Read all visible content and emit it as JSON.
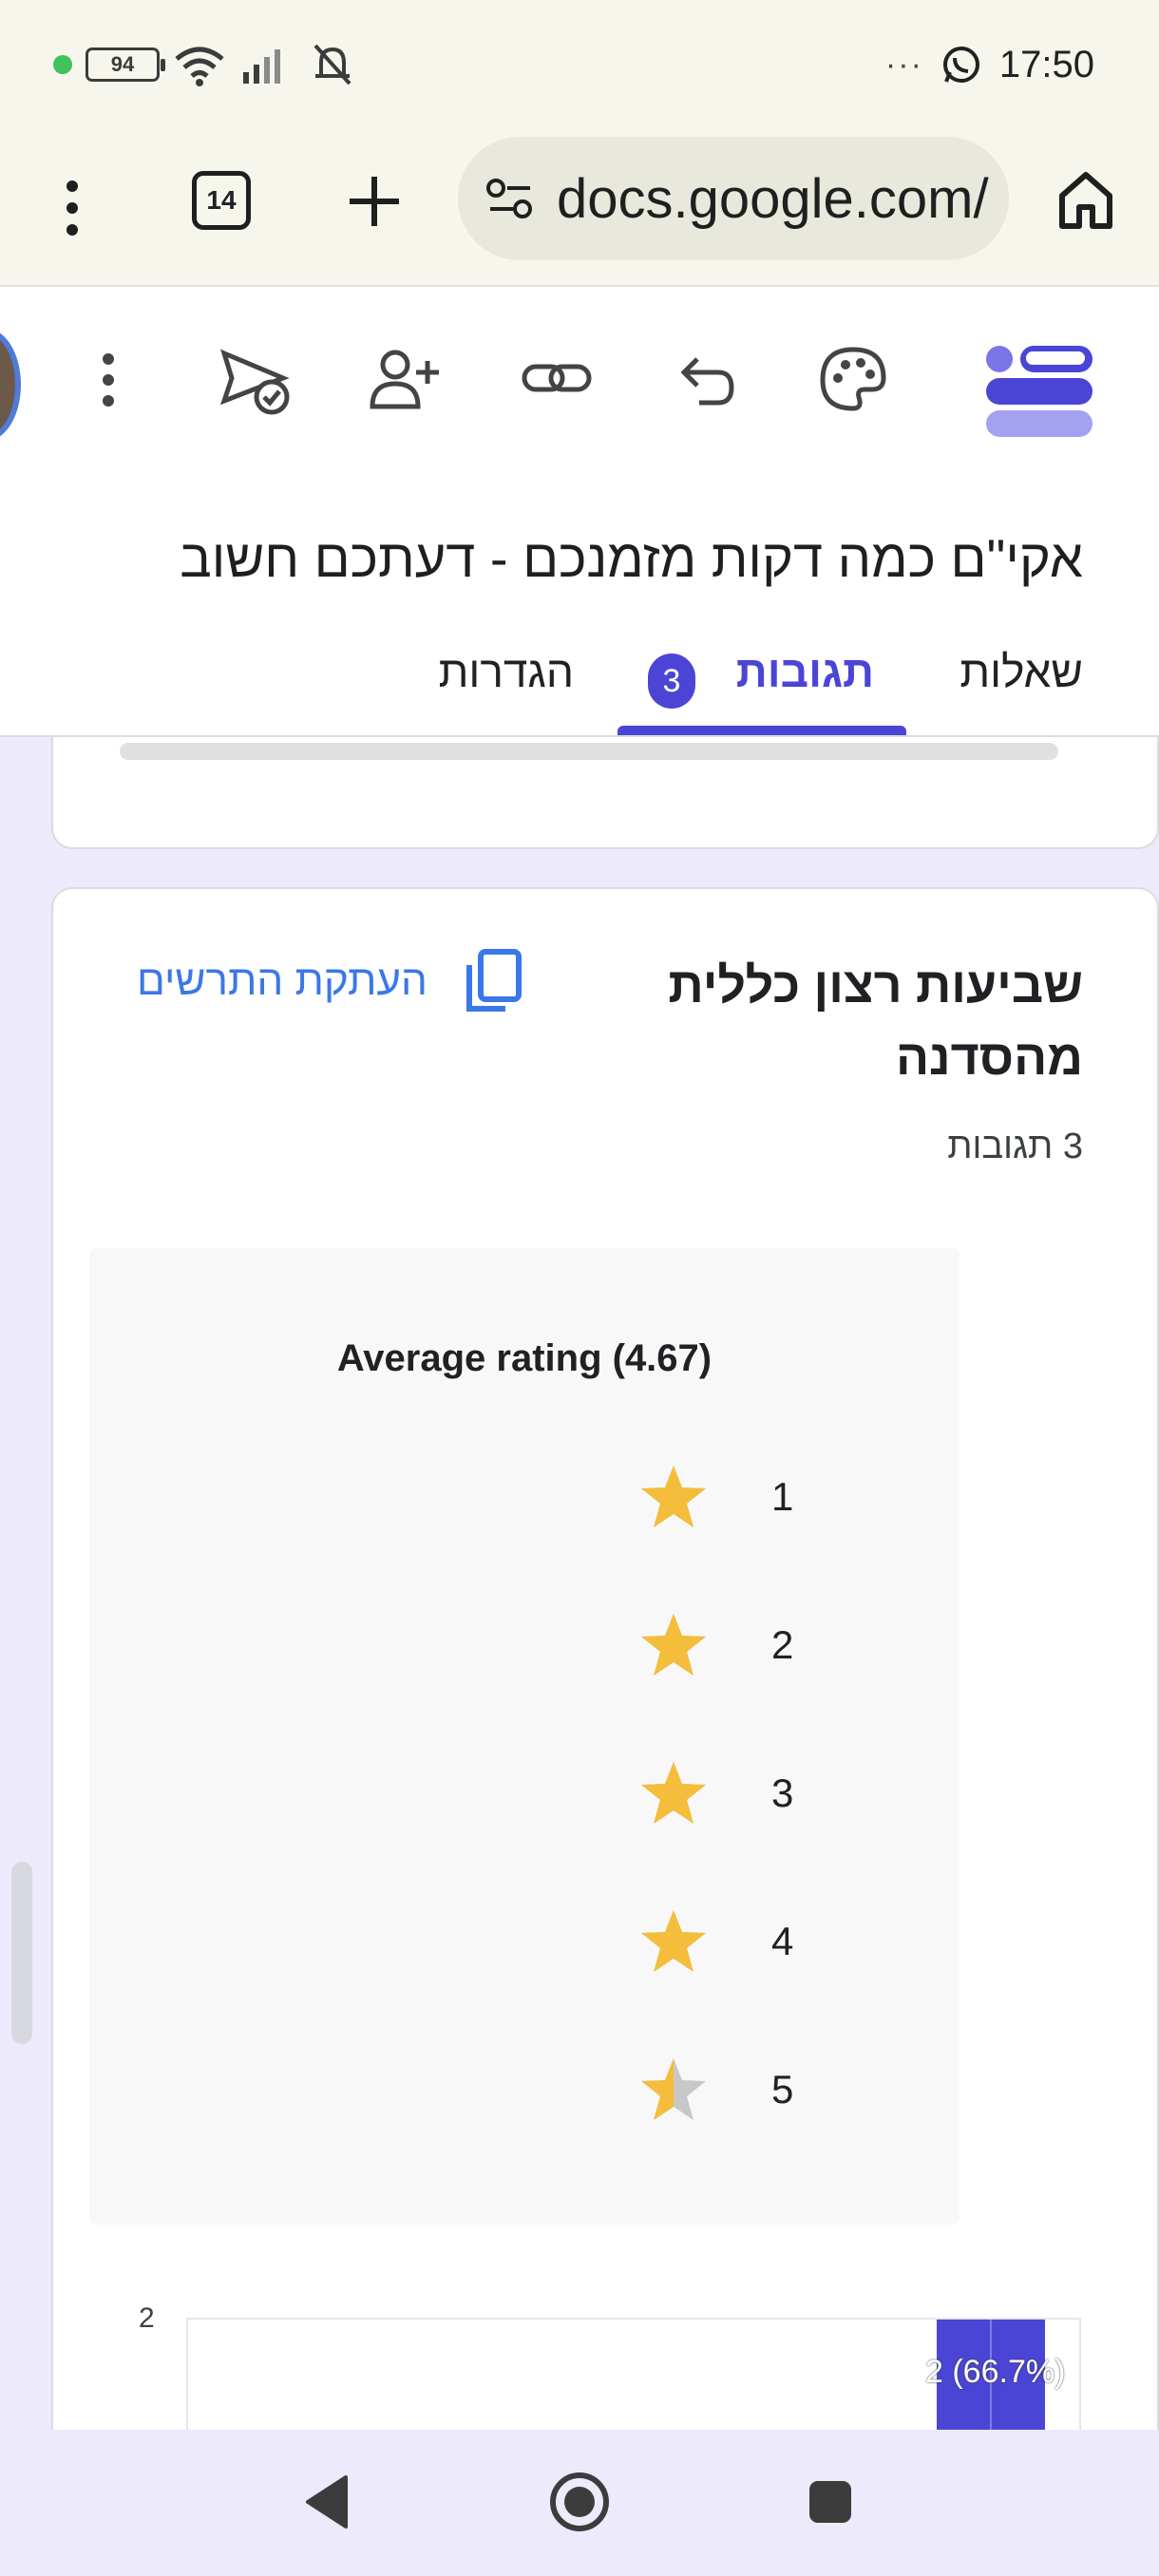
{
  "status_bar": {
    "battery_level": "94",
    "time": "17:50",
    "overflow": "···"
  },
  "browser": {
    "tab_count": "14",
    "url": "docs.google.com/"
  },
  "form": {
    "title": "אקי\"ם כמה דקות מזמנכם - דעתכם חשוב",
    "tabs": {
      "questions": "שאלות",
      "responses": "תגובות",
      "responses_badge": "3",
      "settings": "הגדרות"
    }
  },
  "question": {
    "title": "שביעות רצון כללית מהסדנה",
    "response_count": "3 תגובות",
    "copy_chart_label": "העתקת התרשים"
  },
  "chart_data": [
    {
      "type": "table",
      "title": "Average rating (4.67)",
      "rows": [
        {
          "star": "1",
          "fill": 1.0
        },
        {
          "star": "2",
          "fill": 1.0
        },
        {
          "star": "3",
          "fill": 1.0
        },
        {
          "star": "4",
          "fill": 1.0
        },
        {
          "star": "5",
          "fill": 0.5
        }
      ],
      "star_color": "#f4bd3b",
      "star_empty_color": "#c8c8c8"
    },
    {
      "type": "bar",
      "y_tick_top": "2",
      "bar_label": "2 (66.7%)",
      "values": [
        2
      ],
      "color": "#4b45d6"
    }
  ],
  "colors": {
    "accent": "#4b45d6",
    "link": "#3b78e7",
    "background": "#eceafb"
  }
}
